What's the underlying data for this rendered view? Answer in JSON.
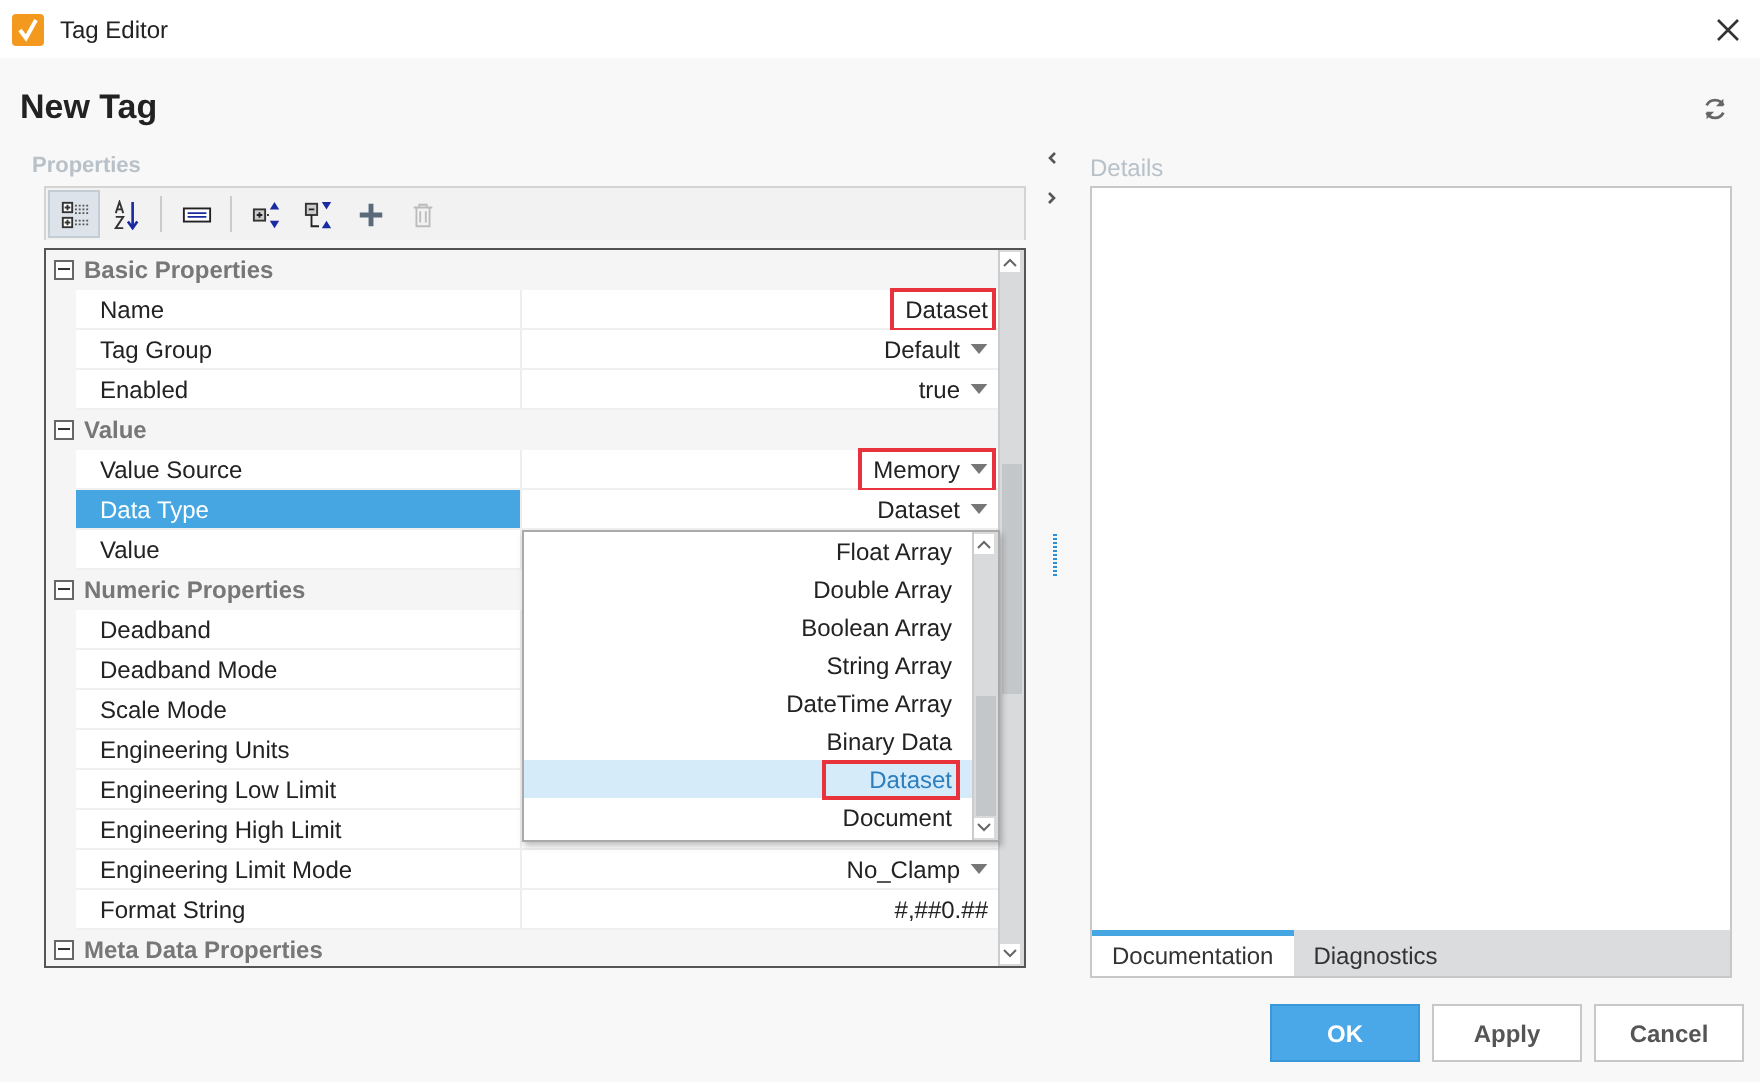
{
  "window": {
    "title": "Tag Editor"
  },
  "heading": "New Tag",
  "properties_label": "Properties",
  "toolbar": [
    {
      "kind": "categorized",
      "selected": true,
      "disabled": false
    },
    {
      "kind": "alphabetical",
      "selected": false,
      "disabled": false
    },
    {
      "kind": "description",
      "selected": false,
      "disabled": false
    },
    {
      "kind": "expand",
      "selected": false,
      "disabled": false
    },
    {
      "kind": "collapse",
      "selected": false,
      "disabled": false
    },
    {
      "kind": "add",
      "selected": false,
      "disabled": false
    },
    {
      "kind": "delete",
      "selected": false,
      "disabled": true
    }
  ],
  "groups": [
    {
      "title": "Basic Properties",
      "expanded": true,
      "rows": [
        {
          "label": "Name",
          "value": "Dataset",
          "kind": "text",
          "selected": false,
          "highlighted": true
        },
        {
          "label": "Tag Group",
          "value": "Default",
          "kind": "dropdown",
          "selected": false,
          "highlighted": false
        },
        {
          "label": "Enabled",
          "value": "true",
          "kind": "dropdown",
          "selected": false,
          "highlighted": false
        }
      ]
    },
    {
      "title": "Value",
      "expanded": true,
      "rows": [
        {
          "label": "Value Source",
          "value": "Memory",
          "kind": "dropdown",
          "selected": false,
          "highlighted": true
        },
        {
          "label": "Data Type",
          "value": "Dataset",
          "kind": "dropdown",
          "selected": true,
          "highlighted": false
        },
        {
          "label": "Value",
          "selected": false
        }
      ]
    },
    {
      "title": "Numeric Properties",
      "expanded": true,
      "rows": [
        {
          "label": "Deadband",
          "selected": false
        },
        {
          "label": "Deadband Mode",
          "selected": false
        },
        {
          "label": "Scale Mode",
          "selected": false
        },
        {
          "label": "Engineering Units",
          "selected": false
        },
        {
          "label": "Engineering Low Limit",
          "selected": false
        },
        {
          "label": "Engineering High Limit",
          "selected": false
        },
        {
          "label": "Engineering Limit Mode",
          "value": "No_Clamp",
          "kind": "dropdown",
          "selected": false,
          "highlighted": false
        },
        {
          "label": "Format String",
          "value": "#,##0.##",
          "kind": "text",
          "selected": false,
          "highlighted": false
        }
      ]
    },
    {
      "title": "Meta Data Properties",
      "expanded": true
    }
  ],
  "dropdown_options": [
    {
      "label": "Float Array",
      "selected": false,
      "highlighted": false
    },
    {
      "label": "Double Array",
      "selected": false,
      "highlighted": false
    },
    {
      "label": "Boolean Array",
      "selected": false,
      "highlighted": false
    },
    {
      "label": "String Array",
      "selected": false,
      "highlighted": false
    },
    {
      "label": "DateTime Array",
      "selected": false,
      "highlighted": false
    },
    {
      "label": "Binary Data",
      "selected": false,
      "highlighted": false
    },
    {
      "label": "Dataset",
      "selected": true,
      "highlighted": true
    },
    {
      "label": "Document",
      "selected": false,
      "highlighted": false
    }
  ],
  "details_label": "Details",
  "detail_tabs": [
    {
      "label": "Documentation",
      "selected": true
    },
    {
      "label": "Diagnostics",
      "selected": false
    }
  ],
  "buttons": [
    {
      "label": "OK",
      "kind": "primary"
    },
    {
      "label": "Apply",
      "kind": "normal"
    },
    {
      "label": "Cancel",
      "kind": "normal"
    }
  ]
}
